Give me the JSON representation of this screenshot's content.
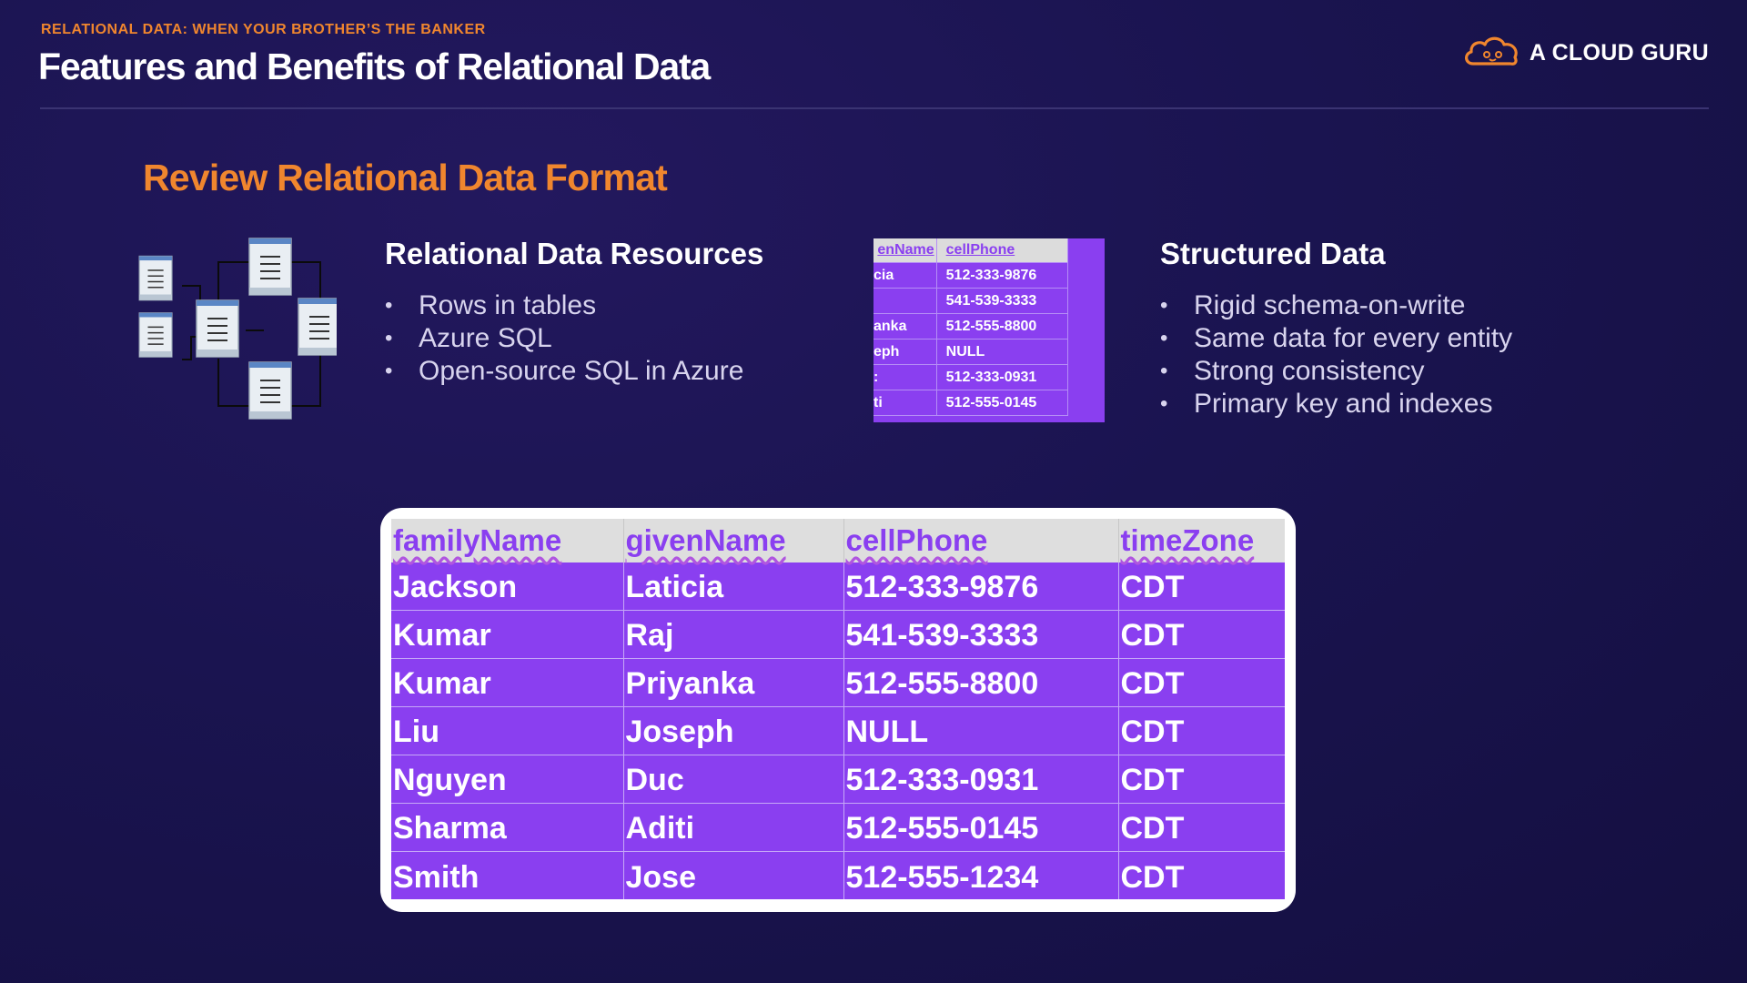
{
  "header": {
    "eyebrow": "RELATIONAL DATA: WHEN YOUR BROTHER’S THE BANKER",
    "title": "Features and Benefits of Relational Data",
    "brand": "A CLOUD GURU"
  },
  "section": {
    "title": "Review Relational Data Format"
  },
  "left_column": {
    "heading": "Relational Data Resources",
    "items": [
      "Rows in tables",
      "Azure SQL",
      "Open-source SQL in Azure"
    ]
  },
  "right_column": {
    "heading": "Structured Data",
    "items": [
      "Rigid schema-on-write",
      "Same data for every entity",
      "Strong consistency",
      "Primary key and indexes"
    ]
  },
  "mini_table": {
    "headers": [
      "enName",
      "cellPhone"
    ],
    "rows": [
      [
        "cia",
        "512-333-9876"
      ],
      [
        "",
        "541-539-3333"
      ],
      [
        "anka",
        "512-555-8800"
      ],
      [
        "eph",
        "NULL"
      ],
      [
        ":",
        "512-333-0931"
      ],
      [
        "ti",
        "512-555-0145"
      ]
    ]
  },
  "table": {
    "headers": [
      "familyName",
      "givenName",
      "cellPhone",
      "timeZone"
    ],
    "rows": [
      [
        "Jackson",
        "Laticia",
        "512-333-9876",
        "CDT"
      ],
      [
        "Kumar",
        "Raj",
        "541-539-3333",
        "CDT"
      ],
      [
        "Kumar",
        "Priyanka",
        "512-555-8800",
        "CDT"
      ],
      [
        "Liu",
        "Joseph",
        "NULL",
        "CDT"
      ],
      [
        "Nguyen",
        "Duc",
        "512-333-0931",
        "CDT"
      ],
      [
        "Sharma",
        "Aditi",
        "512-555-0145",
        "CDT"
      ],
      [
        "Smith",
        "Jose",
        "512-555-1234",
        "CDT"
      ]
    ]
  },
  "colors": {
    "accent": "#f0862e",
    "table_purple": "#8a3ff0",
    "background": "#1a1450"
  },
  "icons": [
    "cloud-logo-icon",
    "er-diagram-icon"
  ]
}
